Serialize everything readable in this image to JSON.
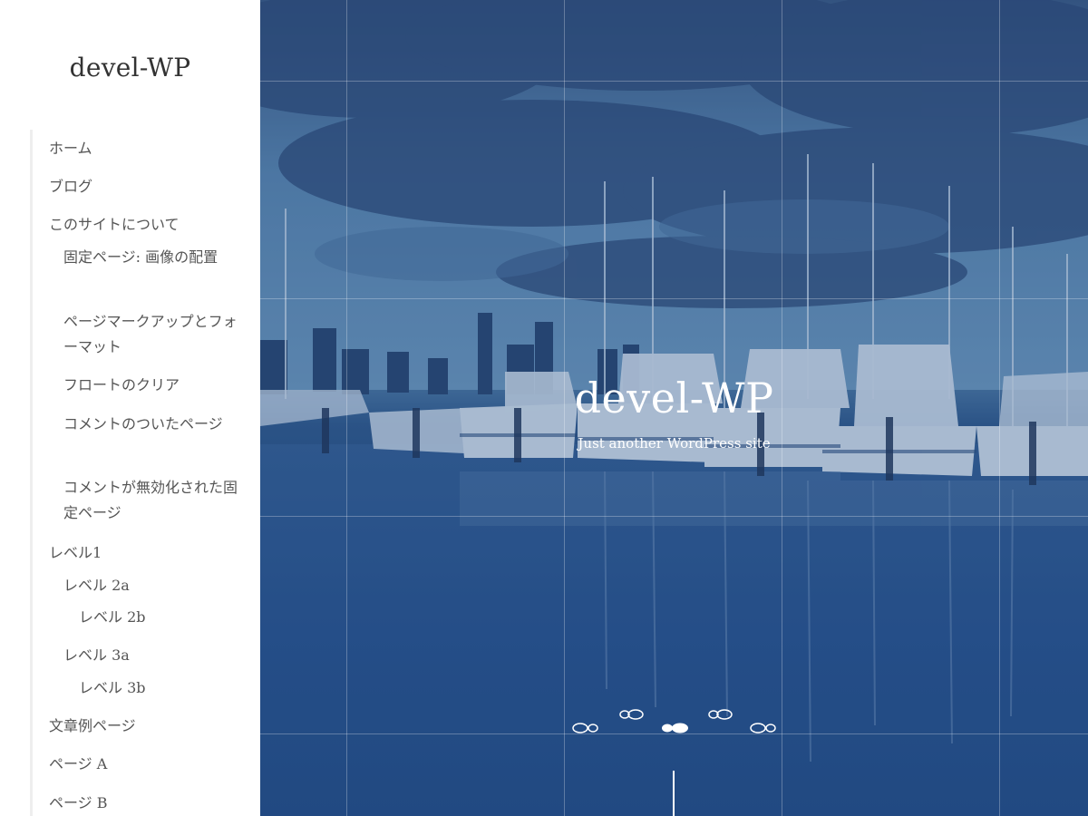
{
  "sidebar": {
    "site_title": "devel-WP",
    "nav": [
      {
        "label": "ホーム",
        "level": 0
      },
      {
        "label": "ブログ",
        "level": 0
      },
      {
        "label": "このサイトについて",
        "level": 0
      },
      {
        "label": "固定ページ: 画像の配置",
        "level": 1
      },
      {
        "label": "ページマークアップとフォーマット",
        "level": 1
      },
      {
        "label": "フロートのクリア",
        "level": 1
      },
      {
        "label": "コメントのついたページ",
        "level": 1
      },
      {
        "label": "コメントが無効化された固定ページ",
        "level": 1
      },
      {
        "label": "レベル1",
        "level": 0
      },
      {
        "label": "レベル 2a",
        "level": 1
      },
      {
        "label": "レベル 2b",
        "level": 2
      },
      {
        "label": "レベル 3a",
        "level": 1
      },
      {
        "label": "レベル 3b",
        "level": 2
      },
      {
        "label": "文章例ページ",
        "level": 0
      },
      {
        "label": "ページ A",
        "level": 0
      },
      {
        "label": "ページ B",
        "level": 0
      }
    ]
  },
  "hero": {
    "title": "devel-WP",
    "tagline": "Just another WordPress site",
    "scroll_icon": "footprints-icon",
    "colors": {
      "overlay": "#2a5a93",
      "text": "#ffffff"
    }
  }
}
